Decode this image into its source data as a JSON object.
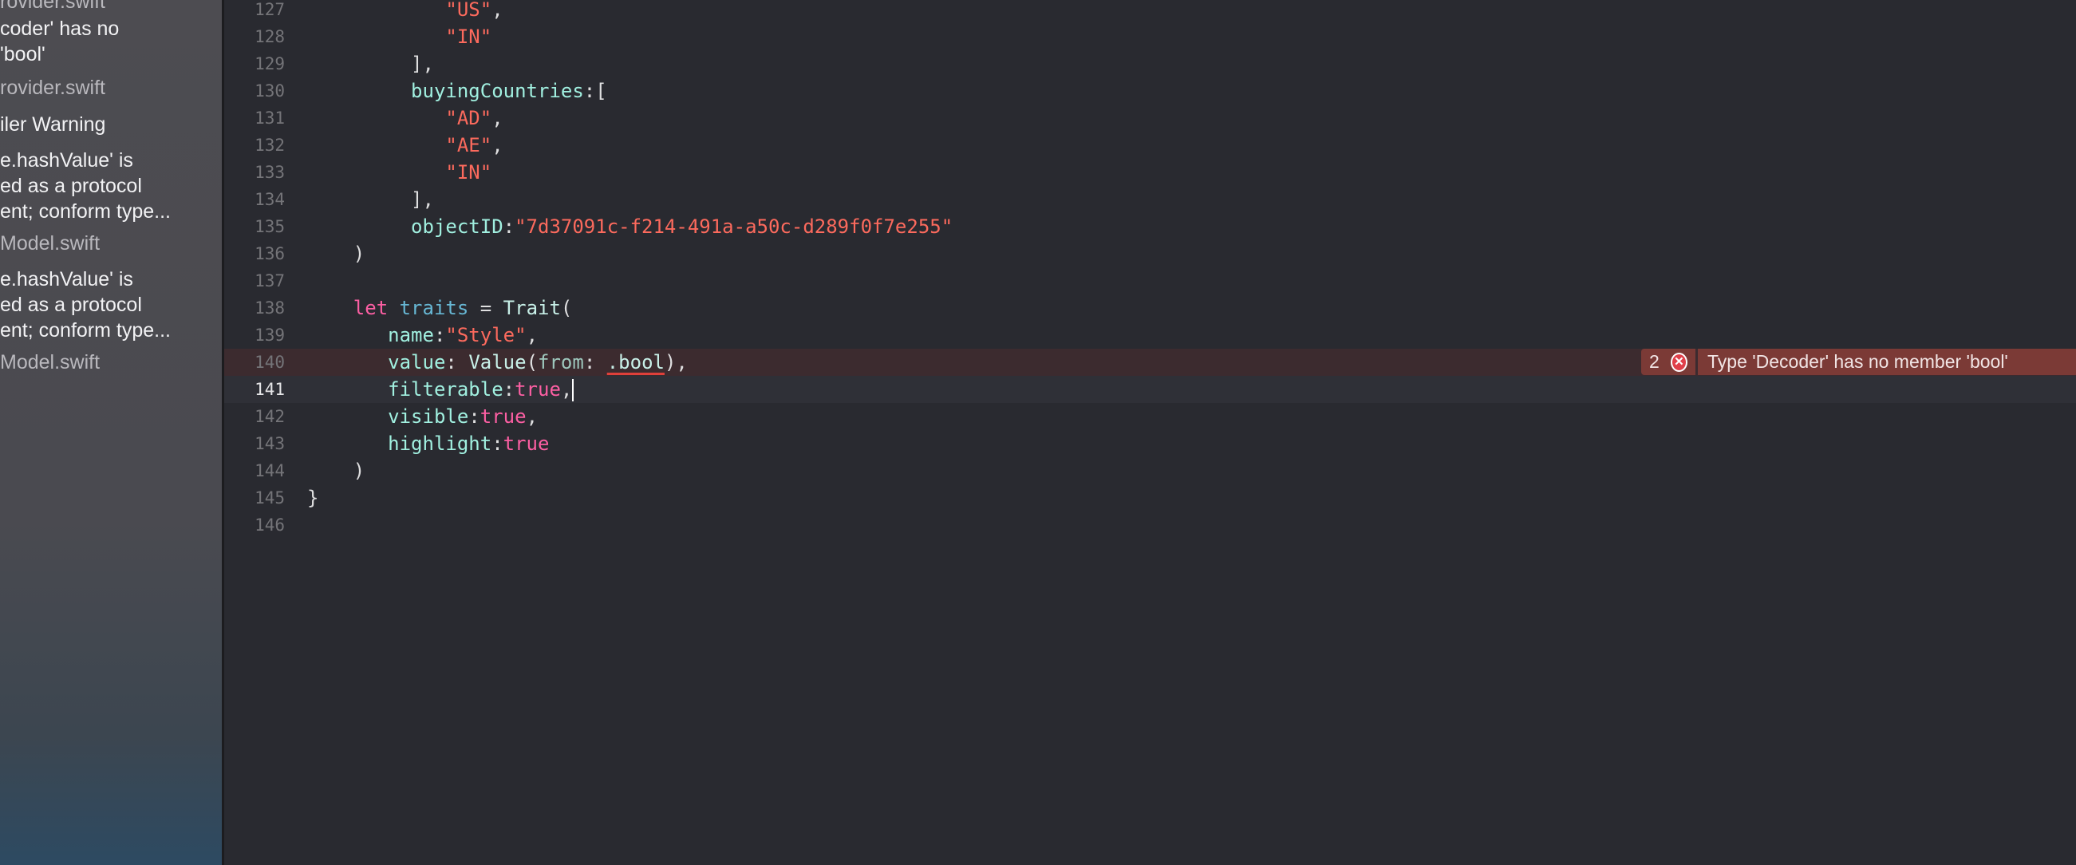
{
  "sidebar": {
    "items": [
      {
        "text": "rovider.swift",
        "kind": "file"
      },
      {
        "text": "coder' has no",
        "kind": "message"
      },
      {
        "text": "'bool'",
        "kind": "message"
      },
      {
        "text": "rovider.swift",
        "kind": "file"
      },
      {
        "text": "iler Warning",
        "kind": "message"
      },
      {
        "text": "e.hashValue' is",
        "kind": "message"
      },
      {
        "text": "ed as a protocol",
        "kind": "message"
      },
      {
        "text": "ent; conform type...",
        "kind": "message"
      },
      {
        "text": "Model.swift",
        "kind": "file"
      },
      {
        "text": "e.hashValue' is",
        "kind": "message"
      },
      {
        "text": "ed as a protocol",
        "kind": "message"
      },
      {
        "text": "ent; conform type...",
        "kind": "message"
      },
      {
        "text": "Model.swift",
        "kind": "file"
      }
    ]
  },
  "editor": {
    "lines": [
      {
        "n": "127",
        "indent": "            ",
        "tokens": [
          [
            "s",
            "\"US\""
          ],
          [
            "",
            ","
          ]
        ]
      },
      {
        "n": "128",
        "indent": "            ",
        "tokens": [
          [
            "s",
            "\"IN\""
          ]
        ]
      },
      {
        "n": "129",
        "indent": "         ",
        "tokens": [
          [
            "",
            "],"
          ]
        ]
      },
      {
        "n": "130",
        "indent": "         ",
        "tokens": [
          [
            "p",
            "buyingCountries"
          ],
          [
            "",
            ":["
          ]
        ]
      },
      {
        "n": "131",
        "indent": "            ",
        "tokens": [
          [
            "s",
            "\"AD\""
          ],
          [
            "",
            ","
          ]
        ]
      },
      {
        "n": "132",
        "indent": "            ",
        "tokens": [
          [
            "s",
            "\"AE\""
          ],
          [
            "",
            ","
          ]
        ]
      },
      {
        "n": "133",
        "indent": "            ",
        "tokens": [
          [
            "s",
            "\"IN\""
          ]
        ]
      },
      {
        "n": "134",
        "indent": "         ",
        "tokens": [
          [
            "",
            "],"
          ]
        ]
      },
      {
        "n": "135",
        "indent": "         ",
        "tokens": [
          [
            "p",
            "objectID"
          ],
          [
            "",
            ":"
          ],
          [
            "s",
            "\"7d37091c-f214-491a-a50c-d289f0f7e255\""
          ]
        ]
      },
      {
        "n": "136",
        "indent": "    ",
        "tokens": [
          [
            "",
            ")"
          ]
        ]
      },
      {
        "n": "137",
        "indent": "",
        "tokens": []
      },
      {
        "n": "138",
        "indent": "    ",
        "tokens": [
          [
            "k",
            "let"
          ],
          [
            "",
            " "
          ],
          [
            "t",
            "traits"
          ],
          [
            "",
            " = "
          ],
          [
            "ty",
            "Trait"
          ],
          [
            "",
            "("
          ]
        ]
      },
      {
        "n": "139",
        "indent": "       ",
        "tokens": [
          [
            "p",
            "name"
          ],
          [
            "",
            ":"
          ],
          [
            "s",
            "\"Style\""
          ],
          [
            "",
            ","
          ]
        ]
      },
      {
        "n": "140",
        "indent": "       ",
        "state": "error",
        "tokens": [
          [
            "p",
            "value"
          ],
          [
            "",
            ": "
          ],
          [
            "ty",
            "Value"
          ],
          [
            "",
            "("
          ],
          [
            "a",
            "from"
          ],
          [
            "",
            ": "
          ],
          [
            "u",
            ".bool"
          ],
          [
            "",
            "),"
          ]
        ]
      },
      {
        "n": "141",
        "indent": "       ",
        "state": "current",
        "tokens": [
          [
            "p",
            "filterable"
          ],
          [
            "",
            ":"
          ],
          [
            "k",
            "true"
          ],
          [
            "",
            ","
          ]
        ]
      },
      {
        "n": "142",
        "indent": "       ",
        "tokens": [
          [
            "p",
            "visible"
          ],
          [
            "",
            ":"
          ],
          [
            "k",
            "true"
          ],
          [
            "",
            ","
          ]
        ]
      },
      {
        "n": "143",
        "indent": "       ",
        "tokens": [
          [
            "p",
            "highlight"
          ],
          [
            "",
            ":"
          ],
          [
            "k",
            "true"
          ]
        ]
      },
      {
        "n": "144",
        "indent": "    ",
        "tokens": [
          [
            "",
            ")"
          ]
        ]
      },
      {
        "n": "145",
        "indent": "",
        "tokens": [
          [
            "",
            "}"
          ]
        ]
      },
      {
        "n": "146",
        "indent": "",
        "tokens": []
      }
    ]
  },
  "error_annotation": {
    "count": "2",
    "icon": "error-x-circle-icon",
    "message": "Type 'Decoder' has no member 'bool'",
    "color": "#7b3a36"
  }
}
